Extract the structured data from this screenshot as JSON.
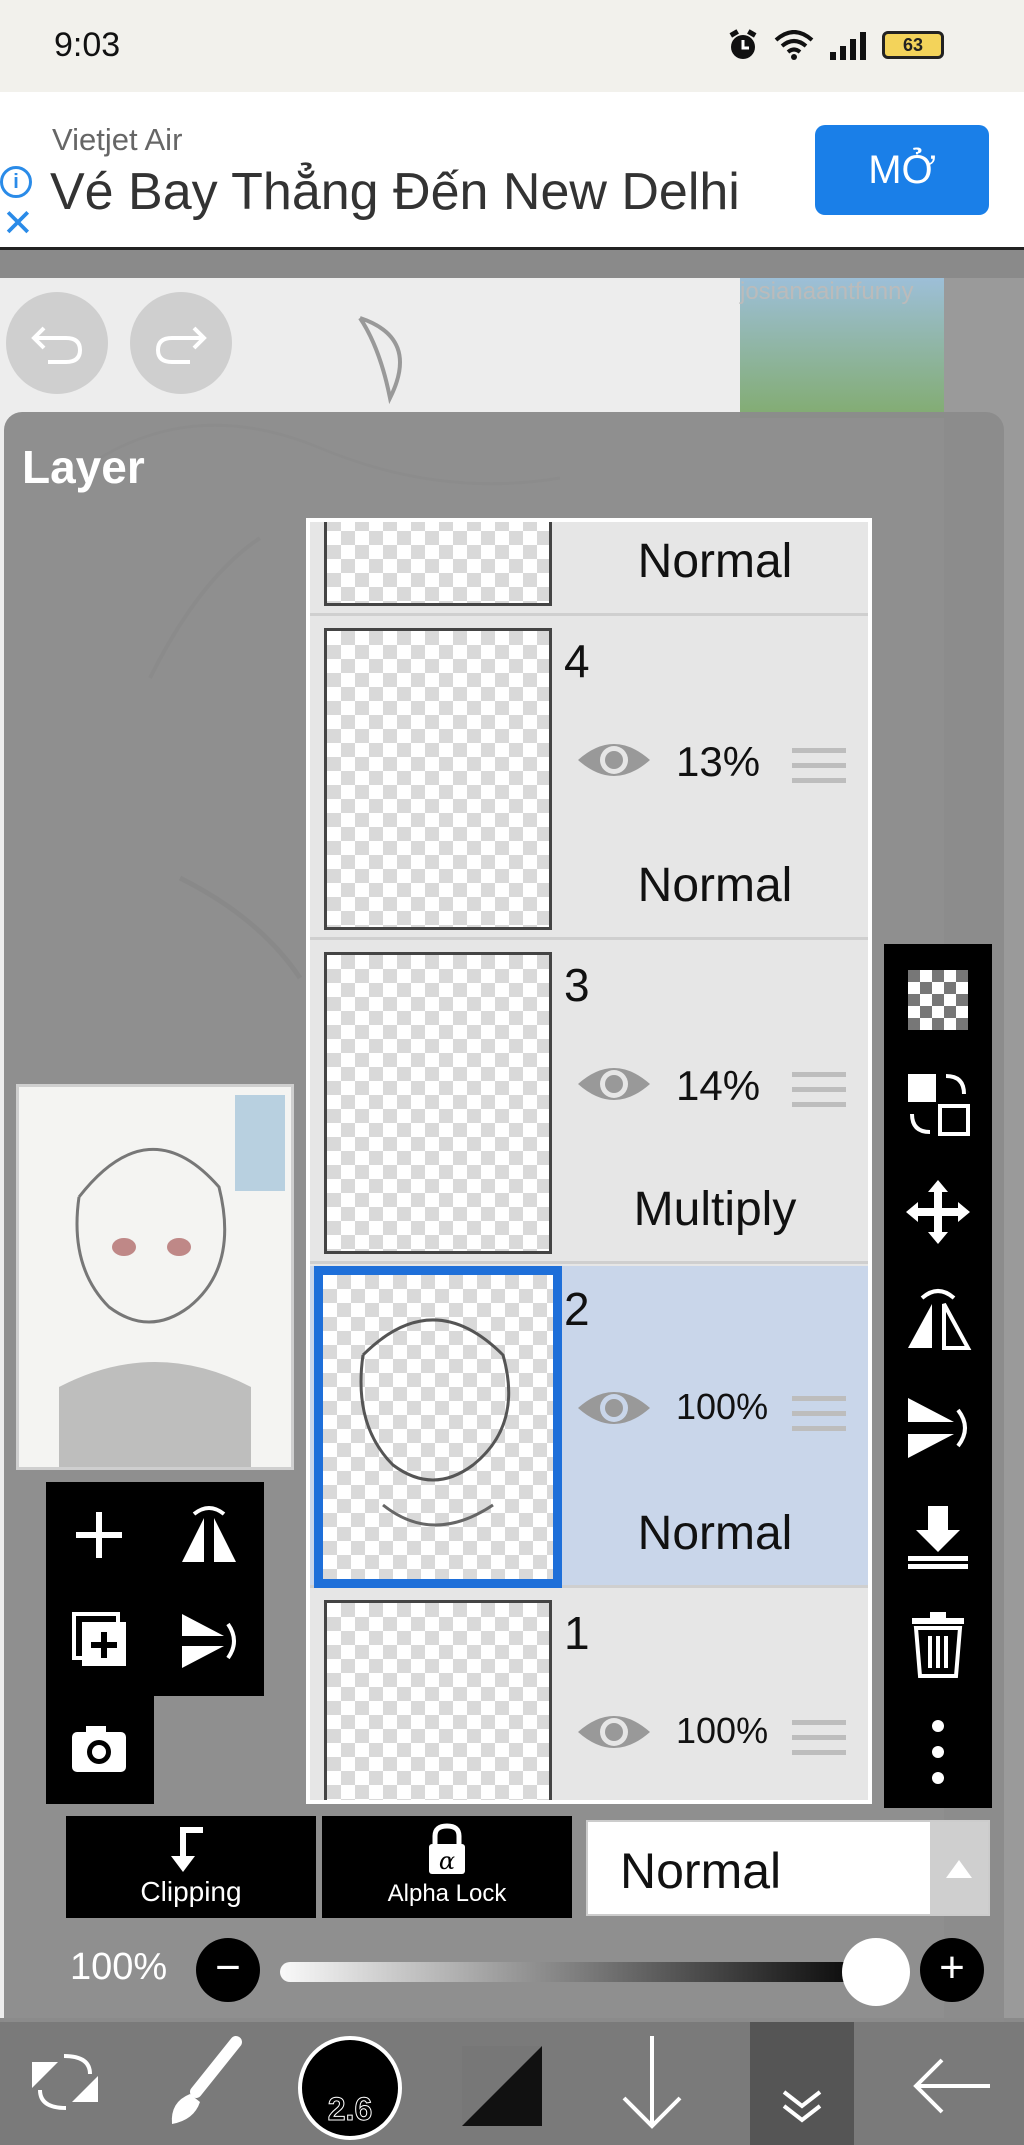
{
  "status_bar": {
    "time": "9:03",
    "battery": "63"
  },
  "ad": {
    "brand": "Vietjet Air",
    "headline": "Vé Bay Thẳng Đến New Delhi",
    "cta": "MỞ"
  },
  "canvas": {
    "reference_text": "josianaaintfunny"
  },
  "panel": {
    "title": "Layer"
  },
  "layers": [
    {
      "number": "",
      "opacity": "",
      "blend": "Normal"
    },
    {
      "number": "4",
      "opacity": "13%",
      "blend": "Normal"
    },
    {
      "number": "3",
      "opacity": "14%",
      "blend": "Multiply"
    },
    {
      "number": "2",
      "opacity": "100%",
      "blend": "Normal",
      "selected": true
    },
    {
      "number": "1",
      "opacity": "100%",
      "blend": ""
    }
  ],
  "bottom_controls": {
    "clipping_label": "Clipping",
    "alpha_lock_label": "Alpha Lock",
    "blend_mode": "Normal",
    "opacity_label": "100%",
    "opacity_value": 1.0
  },
  "bottom_nav": {
    "brush_size": "2.6"
  },
  "colors": {
    "selected_layer_border": "#1e6fd9",
    "selected_layer_bg": "#c9d6ea",
    "ad_button": "#1a7fe8"
  }
}
